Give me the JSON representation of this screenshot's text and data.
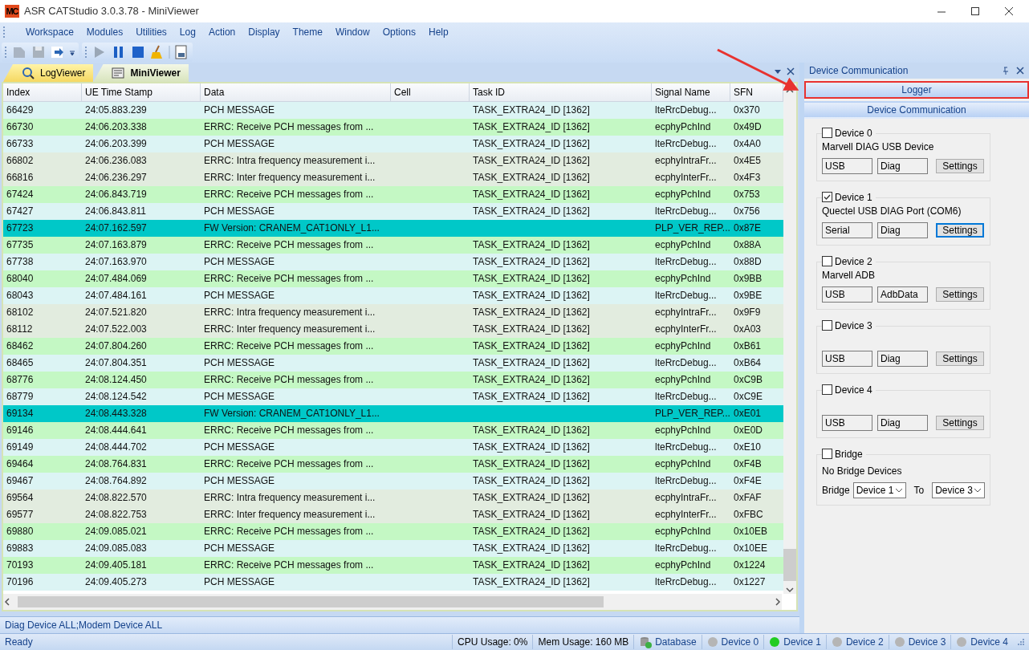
{
  "window": {
    "title": "ASR CATStudio 3.0.3.78 - MiniViewer",
    "logo": "MC"
  },
  "menu": [
    "Workspace",
    "Modules",
    "Utilities",
    "Log",
    "Action",
    "Display",
    "Theme",
    "Window",
    "Options",
    "Help"
  ],
  "tabs": [
    {
      "label": "LogViewer",
      "selected": false
    },
    {
      "label": "MiniViewer",
      "selected": true
    }
  ],
  "table": {
    "columns": [
      "Index",
      "UE Time Stamp",
      "Data",
      "Cell",
      "Task ID",
      "Signal Name",
      "SFN"
    ],
    "rows": [
      {
        "index": "66429",
        "time": "24:05.883.239",
        "data": "PCH MESSAGE",
        "task": "TASK_EXTRA24_ID [1362]",
        "signal": "lteRrcDebug...",
        "sfn": "0x370",
        "color": "#dcf4f4"
      },
      {
        "index": "66730",
        "time": "24:06.203.338",
        "data": "ERRC: Receive PCH messages from ...",
        "task": "TASK_EXTRA24_ID [1362]",
        "signal": "ecphyPchInd",
        "sfn": "0x49D",
        "color": "#c4f8c4"
      },
      {
        "index": "66733",
        "time": "24:06.203.399",
        "data": "PCH MESSAGE",
        "task": "TASK_EXTRA24_ID [1362]",
        "signal": "lteRrcDebug...",
        "sfn": "0x4A0",
        "color": "#dcf4f4"
      },
      {
        "index": "66802",
        "time": "24:06.236.083",
        "data": "ERRC: Intra frequency measurement i...",
        "task": "TASK_EXTRA24_ID [1362]",
        "signal": "ecphyIntraFr...",
        "sfn": "0x4E5",
        "color": "#e2ecdf"
      },
      {
        "index": "66816",
        "time": "24:06.236.297",
        "data": "ERRC: Inter frequency measurement i...",
        "task": "TASK_EXTRA24_ID [1362]",
        "signal": "ecphyInterFr...",
        "sfn": "0x4F3",
        "color": "#e2ecdf"
      },
      {
        "index": "67424",
        "time": "24:06.843.719",
        "data": "ERRC: Receive PCH messages from ...",
        "task": "TASK_EXTRA24_ID [1362]",
        "signal": "ecphyPchInd",
        "sfn": "0x753",
        "color": "#c4f8c4"
      },
      {
        "index": "67427",
        "time": "24:06.843.811",
        "data": "PCH MESSAGE",
        "task": "TASK_EXTRA24_ID [1362]",
        "signal": "lteRrcDebug...",
        "sfn": "0x756",
        "color": "#dcf4f4"
      },
      {
        "index": "67723",
        "time": "24:07.162.597",
        "data": "FW Version: CRANEM_CAT1ONLY_L1...",
        "signal": "PLP_VER_REP...",
        "sfn": "0x87E",
        "color": "#00c8c8"
      },
      {
        "index": "67735",
        "time": "24:07.163.879",
        "data": "ERRC: Receive PCH messages from ...",
        "task": "TASK_EXTRA24_ID [1362]",
        "signal": "ecphyPchInd",
        "sfn": "0x88A",
        "color": "#c4f8c4"
      },
      {
        "index": "67738",
        "time": "24:07.163.970",
        "data": "PCH MESSAGE",
        "task": "TASK_EXTRA24_ID [1362]",
        "signal": "lteRrcDebug...",
        "sfn": "0x88D",
        "color": "#dcf4f4"
      },
      {
        "index": "68040",
        "time": "24:07.484.069",
        "data": "ERRC: Receive PCH messages from ...",
        "task": "TASK_EXTRA24_ID [1362]",
        "signal": "ecphyPchInd",
        "sfn": "0x9BB",
        "color": "#c4f8c4"
      },
      {
        "index": "68043",
        "time": "24:07.484.161",
        "data": "PCH MESSAGE",
        "task": "TASK_EXTRA24_ID [1362]",
        "signal": "lteRrcDebug...",
        "sfn": "0x9BE",
        "color": "#dcf4f4"
      },
      {
        "index": "68102",
        "time": "24:07.521.820",
        "data": "ERRC: Intra frequency measurement i...",
        "task": "TASK_EXTRA24_ID [1362]",
        "signal": "ecphyIntraFr...",
        "sfn": "0x9F9",
        "color": "#e2ecdf"
      },
      {
        "index": "68112",
        "time": "24:07.522.003",
        "data": "ERRC: Inter frequency measurement i...",
        "task": "TASK_EXTRA24_ID [1362]",
        "signal": "ecphyInterFr...",
        "sfn": "0xA03",
        "color": "#e2ecdf"
      },
      {
        "index": "68462",
        "time": "24:07.804.260",
        "data": "ERRC: Receive PCH messages from ...",
        "task": "TASK_EXTRA24_ID [1362]",
        "signal": "ecphyPchInd",
        "sfn": "0xB61",
        "color": "#c4f8c4"
      },
      {
        "index": "68465",
        "time": "24:07.804.351",
        "data": "PCH MESSAGE",
        "task": "TASK_EXTRA24_ID [1362]",
        "signal": "lteRrcDebug...",
        "sfn": "0xB64",
        "color": "#dcf4f4"
      },
      {
        "index": "68776",
        "time": "24:08.124.450",
        "data": "ERRC: Receive PCH messages from ...",
        "task": "TASK_EXTRA24_ID [1362]",
        "signal": "ecphyPchInd",
        "sfn": "0xC9B",
        "color": "#c4f8c4"
      },
      {
        "index": "68779",
        "time": "24:08.124.542",
        "data": "PCH MESSAGE",
        "task": "TASK_EXTRA24_ID [1362]",
        "signal": "lteRrcDebug...",
        "sfn": "0xC9E",
        "color": "#dcf4f4"
      },
      {
        "index": "69134",
        "time": "24:08.443.328",
        "data": "FW Version: CRANEM_CAT1ONLY_L1...",
        "signal": "PLP_VER_REP...",
        "sfn": "0xE01",
        "color": "#00c8c8"
      },
      {
        "index": "69146",
        "time": "24:08.444.641",
        "data": "ERRC: Receive PCH messages from ...",
        "task": "TASK_EXTRA24_ID [1362]",
        "signal": "ecphyPchInd",
        "sfn": "0xE0D",
        "color": "#c4f8c4"
      },
      {
        "index": "69149",
        "time": "24:08.444.702",
        "data": "PCH MESSAGE",
        "task": "TASK_EXTRA24_ID [1362]",
        "signal": "lteRrcDebug...",
        "sfn": "0xE10",
        "color": "#dcf4f4"
      },
      {
        "index": "69464",
        "time": "24:08.764.831",
        "data": "ERRC: Receive PCH messages from ...",
        "task": "TASK_EXTRA24_ID [1362]",
        "signal": "ecphyPchInd",
        "sfn": "0xF4B",
        "color": "#c4f8c4"
      },
      {
        "index": "69467",
        "time": "24:08.764.892",
        "data": "PCH MESSAGE",
        "task": "TASK_EXTRA24_ID [1362]",
        "signal": "lteRrcDebug...",
        "sfn": "0xF4E",
        "color": "#dcf4f4"
      },
      {
        "index": "69564",
        "time": "24:08.822.570",
        "data": "ERRC: Intra frequency measurement i...",
        "task": "TASK_EXTRA24_ID [1362]",
        "signal": "ecphyIntraFr...",
        "sfn": "0xFAF",
        "color": "#e2ecdf"
      },
      {
        "index": "69577",
        "time": "24:08.822.753",
        "data": "ERRC: Inter frequency measurement i...",
        "task": "TASK_EXTRA24_ID [1362]",
        "signal": "ecphyInterFr...",
        "sfn": "0xFBC",
        "color": "#e2ecdf"
      },
      {
        "index": "69880",
        "time": "24:09.085.021",
        "data": "ERRC: Receive PCH messages from ...",
        "task": "TASK_EXTRA24_ID [1362]",
        "signal": "ecphyPchInd",
        "sfn": "0x10EB",
        "color": "#c4f8c4"
      },
      {
        "index": "69883",
        "time": "24:09.085.083",
        "data": "PCH MESSAGE",
        "task": "TASK_EXTRA24_ID [1362]",
        "signal": "lteRrcDebug...",
        "sfn": "0x10EE",
        "color": "#dcf4f4"
      },
      {
        "index": "70193",
        "time": "24:09.405.181",
        "data": "ERRC: Receive PCH messages from ...",
        "task": "TASK_EXTRA24_ID [1362]",
        "signal": "ecphyPchInd",
        "sfn": "0x1224",
        "color": "#c4f8c4"
      },
      {
        "index": "70196",
        "time": "24:09.405.273",
        "data": "PCH MESSAGE",
        "task": "TASK_EXTRA24_ID [1362]",
        "signal": "lteRrcDebug...",
        "sfn": "0x1227",
        "color": "#dcf4f4"
      }
    ]
  },
  "filter_bar": "Diag Device ALL;Modem Device ALL",
  "device_panel": {
    "title": "Device Communication",
    "sections": [
      {
        "label": "Logger",
        "highlighted": true
      },
      {
        "label": "Device Communication",
        "highlighted": false
      }
    ],
    "devices": [
      {
        "name": "Device 0",
        "checked": false,
        "description": "Marvell DIAG USB Device",
        "port": "USB",
        "protocol": "Diag",
        "button": "Settings",
        "focused": false
      },
      {
        "name": "Device 1",
        "checked": true,
        "description": "Quectel USB DIAG Port (COM6)",
        "port": "Serial",
        "protocol": "Diag",
        "button": "Settings",
        "focused": true
      },
      {
        "name": "Device 2",
        "checked": false,
        "description": "Marvell ADB",
        "port": "USB",
        "protocol": "AdbData",
        "button": "Settings",
        "focused": false
      },
      {
        "name": "Device 3",
        "checked": false,
        "port": "USB",
        "protocol": "Diag",
        "button": "Settings",
        "focused": false
      },
      {
        "name": "Device 4",
        "checked": false,
        "port": "USB",
        "protocol": "Diag",
        "button": "Settings",
        "focused": false
      }
    ],
    "bridge": {
      "name": "Bridge",
      "checked": false,
      "status": "No Bridge Devices",
      "label": "Bridge",
      "from": "Device 1",
      "to_label": "To",
      "to": "Device 3"
    }
  },
  "status_bar": {
    "ready": "Ready",
    "cpu": "CPU Usage:  0%",
    "mem": "Mem Usage: 160 MB",
    "database": "Database",
    "devices": [
      {
        "label": "Device 0",
        "on": false
      },
      {
        "label": "Device 1",
        "on": true
      },
      {
        "label": "Device 2",
        "on": false
      },
      {
        "label": "Device 3",
        "on": false
      },
      {
        "label": "Device 4",
        "on": false
      }
    ]
  }
}
